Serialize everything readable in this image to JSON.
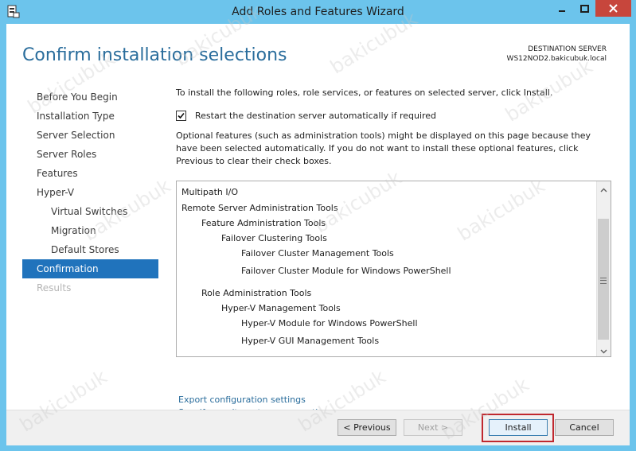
{
  "window": {
    "title": "Add Roles and Features Wizard",
    "controls": [
      "minimize-icon",
      "maximize-icon",
      "close-icon"
    ]
  },
  "header": {
    "title": "Confirm installation selections",
    "destination_label": "DESTINATION SERVER",
    "destination_server": "WS12NOD2.bakicubuk.local"
  },
  "nav": {
    "items": [
      {
        "label": "Before You Begin",
        "state": "normal"
      },
      {
        "label": "Installation Type",
        "state": "normal"
      },
      {
        "label": "Server Selection",
        "state": "normal"
      },
      {
        "label": "Server Roles",
        "state": "normal"
      },
      {
        "label": "Features",
        "state": "normal"
      },
      {
        "label": "Hyper-V",
        "state": "normal"
      },
      {
        "label": "Virtual Switches",
        "state": "sub"
      },
      {
        "label": "Migration",
        "state": "sub"
      },
      {
        "label": "Default Stores",
        "state": "sub"
      },
      {
        "label": "Confirmation",
        "state": "active"
      },
      {
        "label": "Results",
        "state": "disabled"
      }
    ]
  },
  "content": {
    "intro": "To install the following roles, role services, or features on selected server, click Install.",
    "restart_checkbox": {
      "label": "Restart the destination server automatically if required",
      "checked": true
    },
    "optional_text": "Optional features (such as administration tools) might be displayed on this page because they have been selected automatically. If you do not want to install these optional features, click Previous to clear their check boxes.",
    "selections": [
      {
        "text": "Multipath I/O",
        "level": 0
      },
      {
        "text": "Remote Server Administration Tools",
        "level": 0
      },
      {
        "text": "Feature Administration Tools",
        "level": 1
      },
      {
        "text": "Failover Clustering Tools",
        "level": 2
      },
      {
        "text": "Failover Cluster Management Tools",
        "level": 3
      },
      {
        "text": "Failover Cluster Module for Windows PowerShell",
        "level": 3
      },
      {
        "text": "Role Administration Tools",
        "level": 1
      },
      {
        "text": "Hyper-V Management Tools",
        "level": 2
      },
      {
        "text": "Hyper-V Module for Windows PowerShell",
        "level": 3
      },
      {
        "text": "Hyper-V GUI Management Tools",
        "level": 3
      }
    ],
    "links": {
      "export": "Export configuration settings",
      "alternate_source": "Specify an alternate source path"
    }
  },
  "footer": {
    "previous": "< Previous",
    "next": "Next >",
    "install": "Install",
    "cancel": "Cancel"
  },
  "watermark": "bakicubuk",
  "colors": {
    "title_bar": "#6cc4ec",
    "accent": "#2a6d9c",
    "nav_active": "#2073bc",
    "close_button": "#c7463c",
    "highlight_box": "#c0282e"
  }
}
